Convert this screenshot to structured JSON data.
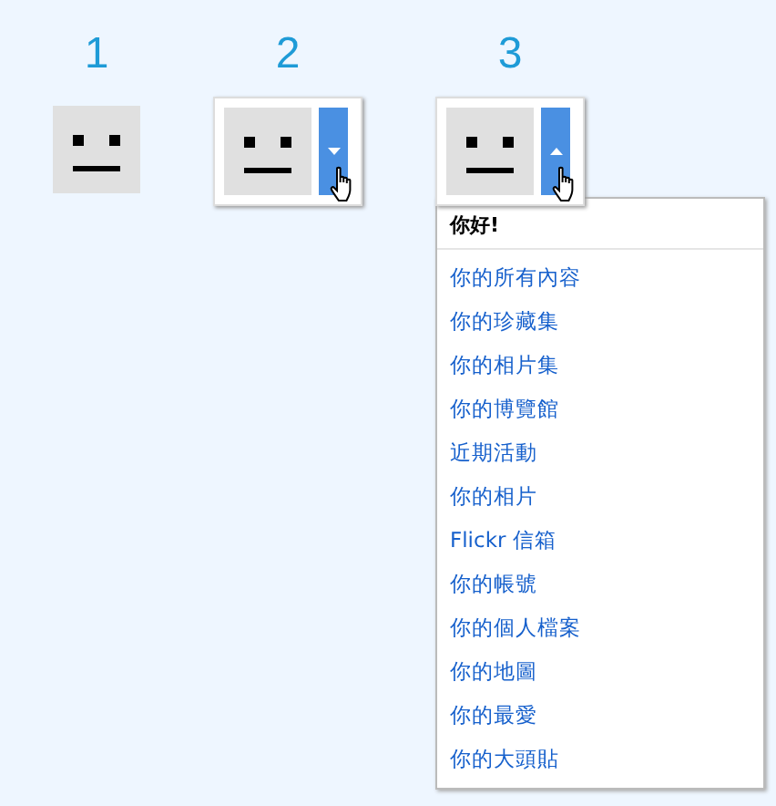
{
  "columns": [
    {
      "number": "1",
      "kind": "avatar"
    },
    {
      "number": "2",
      "kind": "dropdown",
      "expanded": false
    },
    {
      "number": "3",
      "kind": "dropdown",
      "expanded": true,
      "menu": {
        "greeting": "你好!",
        "items": [
          "你的所有內容",
          "你的珍藏集",
          "你的相片集",
          "你的博覽館",
          "近期活動",
          "你的相片",
          "Flickr 信箱",
          "你的帳號",
          "你的個人檔案",
          "你的地圖",
          "你的最愛",
          "你的大頭貼"
        ]
      }
    }
  ]
}
